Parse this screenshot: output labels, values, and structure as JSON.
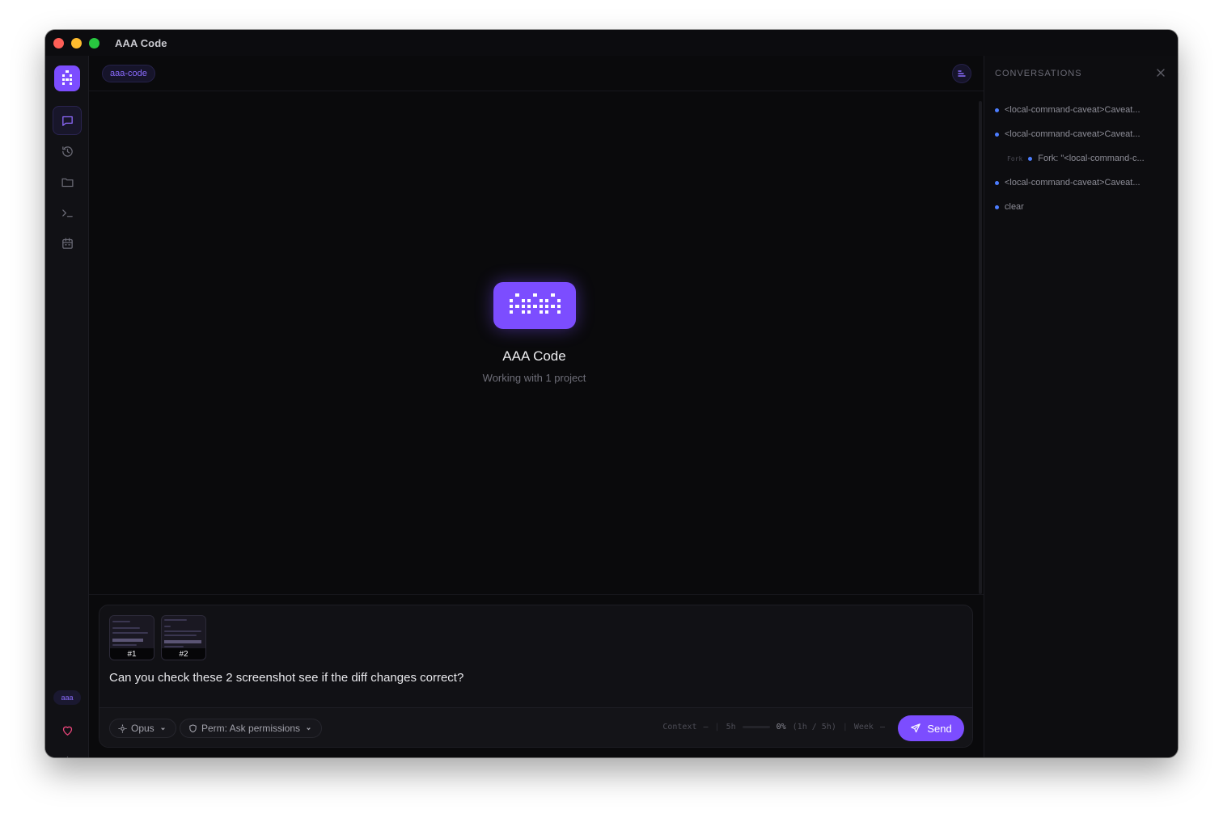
{
  "window": {
    "title": "AAA Code"
  },
  "project_chip": "aaa-code",
  "rail": {
    "badge": "aaa"
  },
  "hero": {
    "title": "AAA Code",
    "subtitle": "Working with 1 project"
  },
  "composer": {
    "attachments": [
      {
        "label": "#1"
      },
      {
        "label": "#2"
      }
    ],
    "prompt_text": "Can you check these 2 screenshot see if the diff changes correct?",
    "model_label": "Opus",
    "perm_label": "Perm: Ask permissions",
    "usage": {
      "context_label": "Context",
      "context_value": "–",
      "window_label": "5h",
      "window_value": "0%",
      "window_detail": "(1h / 5h)",
      "week_label": "Week",
      "week_value": "–"
    },
    "send_label": "Send"
  },
  "conversations": {
    "header": "CONVERSATIONS",
    "items": [
      {
        "text": "<local-command-caveat>Caveat..."
      },
      {
        "text": "<local-command-caveat>Caveat..."
      },
      {
        "fork_tag": "Fork",
        "text": "Fork: \"<local-command-c..."
      },
      {
        "text": "<local-command-caveat>Caveat..."
      },
      {
        "text": "clear"
      }
    ]
  },
  "colors": {
    "accent": "#7c4dff",
    "dot": "#4c7dff",
    "background": "#0a0a0c"
  }
}
